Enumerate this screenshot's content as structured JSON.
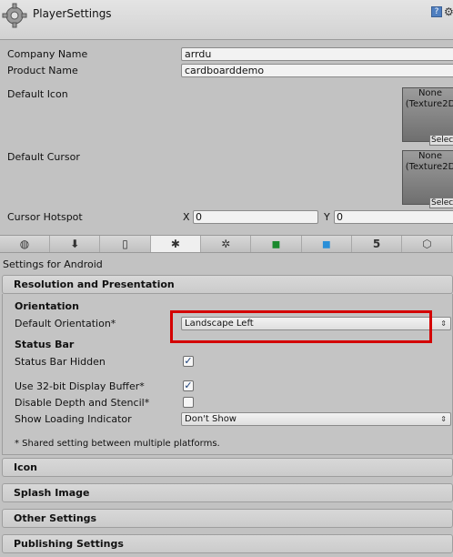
{
  "header": {
    "title": "PlayerSettings",
    "help_icon": "?",
    "settings_icon": "⚙"
  },
  "fields": {
    "company_name": {
      "label": "Company Name",
      "value": "arrdu"
    },
    "product_name": {
      "label": "Product Name",
      "value": "cardboarddemo"
    },
    "default_icon": {
      "label": "Default Icon",
      "texture": "None\n(Texture2D",
      "select": "Select"
    },
    "default_cursor": {
      "label": "Default Cursor",
      "texture": "None\n(Texture2D",
      "select": "Select"
    },
    "cursor_hotspot": {
      "label": "Cursor Hotspot",
      "x_label": "X",
      "x_value": "0",
      "y_label": "Y",
      "y_value": "0"
    }
  },
  "platform_tabs": [
    {
      "icon": "globe-icon",
      "glyph": "◍"
    },
    {
      "icon": "download-icon",
      "glyph": "⬇"
    },
    {
      "icon": "mobile-icon",
      "glyph": "▯"
    },
    {
      "icon": "android-icon",
      "glyph": "✱",
      "active": true
    },
    {
      "icon": "blackberry-icon",
      "glyph": "✲"
    },
    {
      "icon": "windows-green-icon",
      "glyph": "◼"
    },
    {
      "icon": "windows-blue-icon",
      "glyph": "◼"
    },
    {
      "icon": "html5-icon",
      "glyph": "5"
    },
    {
      "icon": "cube-icon",
      "glyph": "⬡"
    }
  ],
  "settings_for": "Settings for Android",
  "resolution": {
    "title": "Resolution and Presentation",
    "orientation_header": "Orientation",
    "default_orientation_label": "Default Orientation*",
    "default_orientation_value": "Landscape Left",
    "status_bar_header": "Status Bar",
    "status_bar_hidden_label": "Status Bar Hidden",
    "status_bar_hidden": true,
    "use32_label": "Use 32-bit Display Buffer*",
    "use32": true,
    "disable_depth_label": "Disable Depth and Stencil*",
    "disable_depth": false,
    "loading_indicator_label": "Show Loading Indicator",
    "loading_indicator_value": "Don't Show",
    "note": "* Shared setting between multiple platforms."
  },
  "sections": [
    "Icon",
    "Splash Image",
    "Other Settings",
    "Publishing Settings"
  ],
  "colors": {
    "highlight": "#d40000",
    "android_active_tab": "#efefef"
  }
}
